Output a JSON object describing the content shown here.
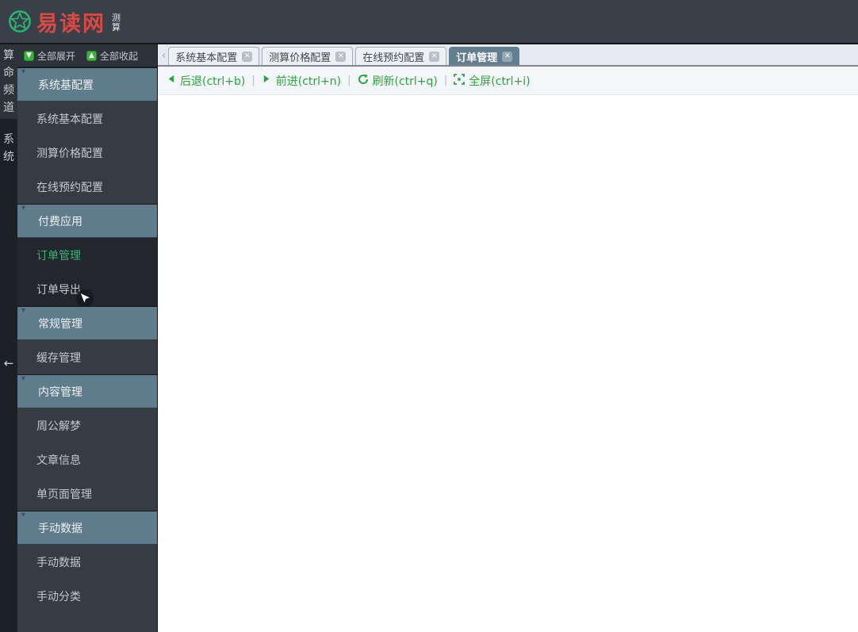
{
  "header": {
    "logo_icon": "star-circle-icon",
    "logo_text": "易读网",
    "logo_sub": "测算"
  },
  "left_strip": {
    "channels": [
      {
        "label": "算命频道",
        "active": true
      },
      {
        "label": "系统",
        "active": false
      }
    ],
    "collapse_arrow": "←"
  },
  "sidebar": {
    "expand_all_label": "全部展开",
    "collapse_all_label": "全部收起",
    "expand_icon": "arrow-down-square-icon",
    "collapse_icon": "arrow-up-square-icon",
    "groups": [
      {
        "label": "系统基配置",
        "dark": false,
        "items": [
          {
            "label": "系统基本配置"
          },
          {
            "label": "测算价格配置"
          },
          {
            "label": "在线预约配置"
          }
        ]
      },
      {
        "label": "付费应用",
        "dark": true,
        "items": [
          {
            "label": "订单管理",
            "selected": true
          },
          {
            "label": "订单导出",
            "cursor": true
          }
        ]
      },
      {
        "label": "常规管理",
        "dark": false,
        "items": [
          {
            "label": "缓存管理"
          }
        ]
      },
      {
        "label": "内容管理",
        "dark": false,
        "items": [
          {
            "label": "周公解梦"
          },
          {
            "label": "文章信息"
          },
          {
            "label": "单页面管理"
          }
        ]
      },
      {
        "label": "手动数据",
        "dark": false,
        "items": [
          {
            "label": "手动数据"
          },
          {
            "label": "手动分类"
          }
        ]
      }
    ]
  },
  "tabbar": {
    "scroll_left_glyph": "‹",
    "tabs": [
      {
        "label": "系统基本配置",
        "active": false
      },
      {
        "label": "测算价格配置",
        "active": false
      },
      {
        "label": "在线预约配置",
        "active": false
      },
      {
        "label": "订单管理",
        "active": true
      }
    ]
  },
  "toolbar": {
    "items": [
      {
        "icon": "back-arrow-icon",
        "label": "后退(ctrl+b)"
      },
      {
        "icon": "forward-arrow-icon",
        "label": "前进(ctrl+n)"
      },
      {
        "icon": "refresh-icon",
        "label": "刷新(ctrl+q)"
      },
      {
        "icon": "fullscreen-icon",
        "label": "全屏(ctrl+i)"
      }
    ],
    "separator": "|"
  },
  "colors": {
    "header_bg": "#394049",
    "logo_red": "#d94a43",
    "logo_green": "#2bb673",
    "sidebar_bg": "#363c44",
    "group_header_bg": "#5e7c8b",
    "selected_group_bg": "#23272d",
    "selected_item_green": "#35b478",
    "active_tab_bg": "#627e8f",
    "toolbar_green": "#2aa63d"
  }
}
